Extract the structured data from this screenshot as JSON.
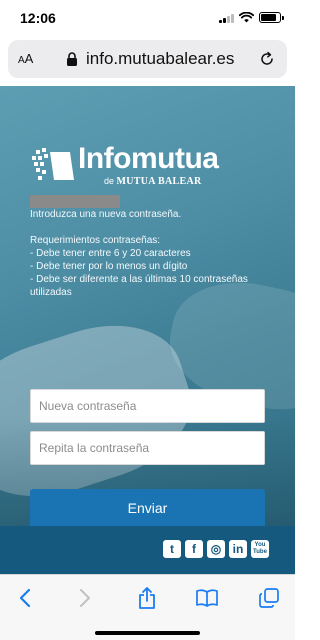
{
  "status_bar": {
    "time": "12:06",
    "battery_level": 0.85
  },
  "url_bar": {
    "aa_small": "A",
    "aa_large": "A",
    "url": "info.mutuabalear.es",
    "lock_icon": "lock-icon",
    "reload_icon": "reload-icon"
  },
  "brand": {
    "logo_text": "Infomutua",
    "logo_sub_prefix": "de ",
    "logo_sub_brand": "MUTUA BALEAR"
  },
  "form": {
    "intro": "Introduzca una nueva contraseña.",
    "requirements_title": "Requerimientos contraseñas:",
    "requirements": [
      "- Debe tener entre 6 y 20 caracteres",
      "- Debe tener por lo menos un dígito",
      "- Debe ser diferente a las últimas 10 contraseñas utilizadas"
    ],
    "new_password_placeholder": "Nueva contraseña",
    "repeat_password_placeholder": "Repita la contraseña",
    "submit_label": "Enviar"
  },
  "footer": {
    "social": [
      {
        "name": "twitter-icon",
        "glyph": "t"
      },
      {
        "name": "facebook-icon",
        "glyph": "f"
      },
      {
        "name": "instagram-icon",
        "glyph": "◎"
      },
      {
        "name": "linkedin-icon",
        "glyph": "in"
      },
      {
        "name": "youtube-icon",
        "glyph_top": "You",
        "glyph_bottom": "Tube"
      }
    ]
  },
  "colors": {
    "accent": "#1a74b4",
    "footer": "#15597e",
    "hero": "#4f8fa6"
  }
}
